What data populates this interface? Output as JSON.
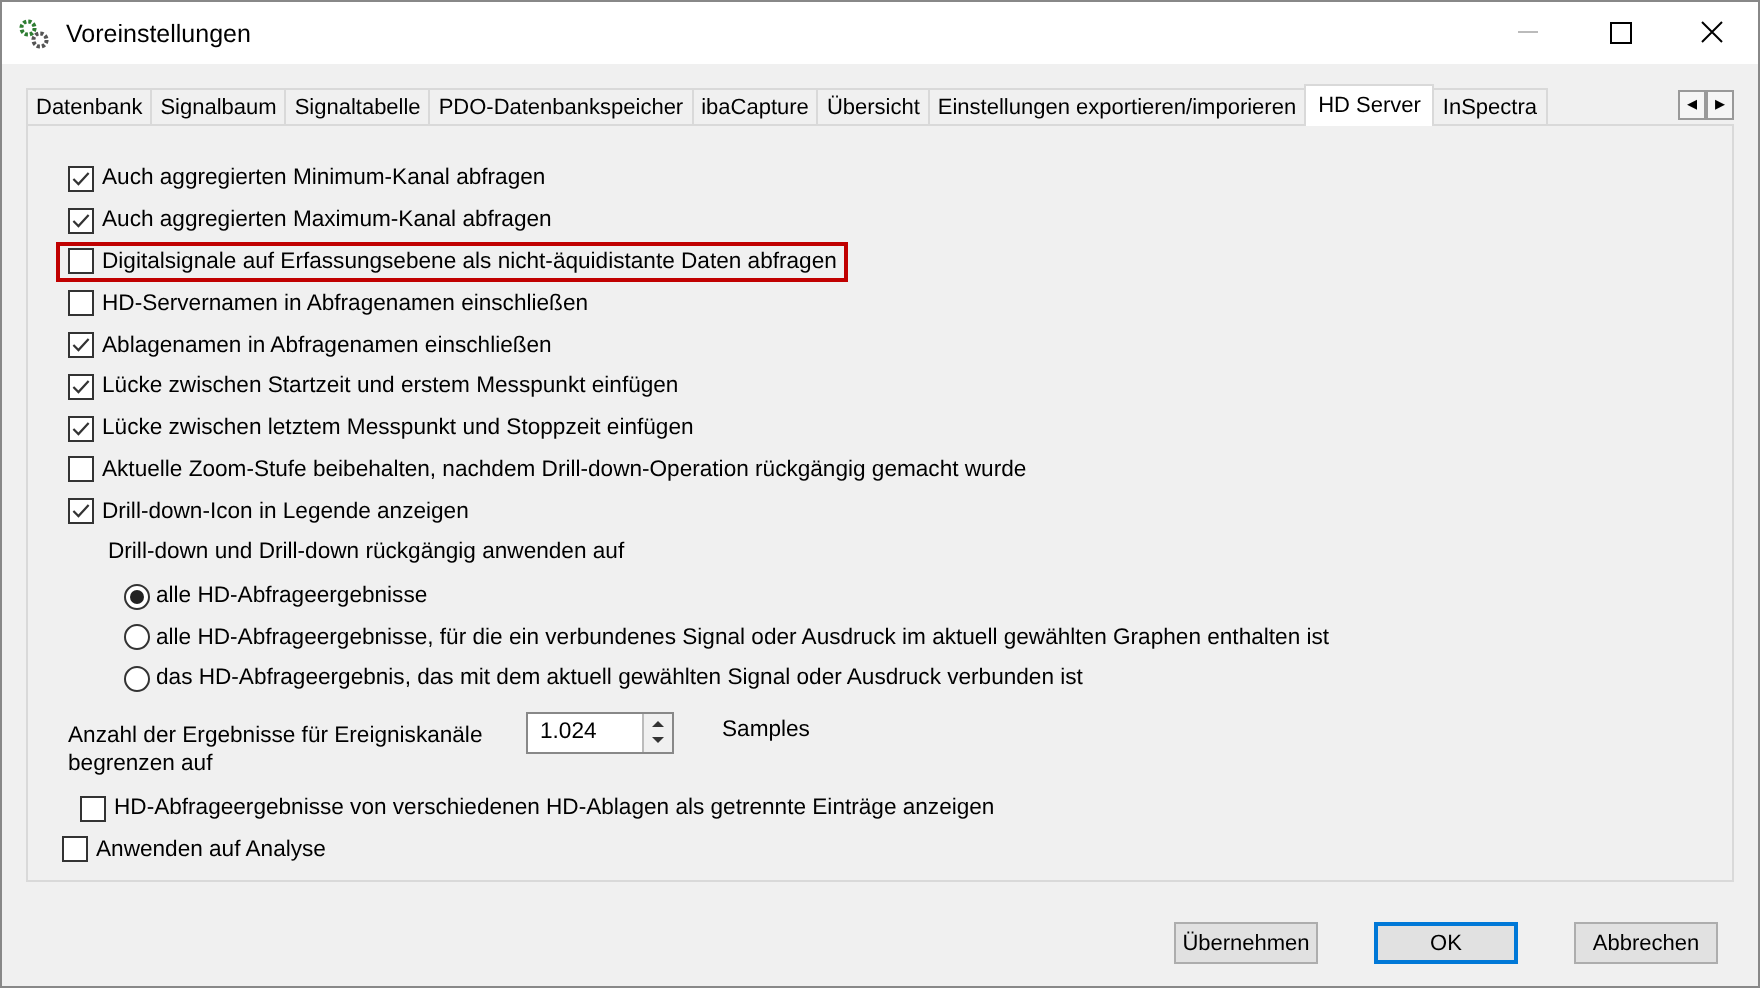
{
  "window": {
    "title": "Voreinstellungen"
  },
  "tabs": [
    {
      "label": "Datenbank",
      "selected": false
    },
    {
      "label": "Signalbaum",
      "selected": false
    },
    {
      "label": "Signaltabelle",
      "selected": false
    },
    {
      "label": "PDO-Datenbankspeicher",
      "selected": false
    },
    {
      "label": "ibaCapture",
      "selected": false
    },
    {
      "label": "Übersicht",
      "selected": false
    },
    {
      "label": "Einstellungen exportieren/imporieren",
      "selected": false
    },
    {
      "label": "HD Server",
      "selected": true
    },
    {
      "label": "InSpectra",
      "selected": false
    }
  ],
  "tab_scroll": {
    "left": "◂",
    "right": "▸"
  },
  "options": [
    {
      "label": "Auch aggregierten Minimum-Kanal abfragen",
      "checked": true,
      "highlighted": false
    },
    {
      "label": "Auch aggregierten Maximum-Kanal abfragen",
      "checked": true,
      "highlighted": false
    },
    {
      "label": "Digitalsignale auf Erfassungsebene als nicht-äquidistante Daten abfragen",
      "checked": false,
      "highlighted": true
    },
    {
      "label": "HD-Servernamen in Abfragenamen einschließen",
      "checked": false,
      "highlighted": false
    },
    {
      "label": "Ablagenamen in Abfragenamen einschließen",
      "checked": true,
      "highlighted": false
    },
    {
      "label": "Lücke zwischen Startzeit und erstem Messpunkt einfügen",
      "checked": true,
      "highlighted": false
    },
    {
      "label": "Lücke zwischen letztem Messpunkt und Stoppzeit einfügen",
      "checked": true,
      "highlighted": false
    },
    {
      "label": "Aktuelle Zoom-Stufe beibehalten, nachdem Drill-down-Operation rückgängig gemacht wurde",
      "checked": false,
      "highlighted": false
    },
    {
      "label": "Drill-down-Icon in Legende anzeigen",
      "checked": true,
      "highlighted": false
    }
  ],
  "drilldown": {
    "label": "Drill-down und Drill-down rückgängig anwenden auf",
    "choices": [
      {
        "label": "alle HD-Abfrageergebnisse",
        "selected": true
      },
      {
        "label": "alle HD-Abfrageergebnisse, für die ein verbundenes Signal oder Ausdruck im aktuell gewählten Graphen enthalten ist",
        "selected": false
      },
      {
        "label": "das HD-Abfrageergebnis, das mit dem aktuell gewählten Signal oder Ausdruck verbunden ist",
        "selected": false
      }
    ]
  },
  "event_limit": {
    "label": "Anzahl der Ergebnisse für Ereigniskanäle begrenzen auf",
    "value": "1.024",
    "unit": "Samples"
  },
  "separate_entries": {
    "label": "HD-Abfrageergebnisse von verschiedenen HD-Ablagen als getrennte Einträge anzeigen",
    "checked": false
  },
  "apply_to_analysis": {
    "label": "Anwenden auf Analyse",
    "checked": false
  },
  "buttons": [
    {
      "label": "Übernehmen",
      "default": false
    },
    {
      "label": "OK",
      "default": true
    },
    {
      "label": "Abbrechen",
      "default": false
    }
  ]
}
